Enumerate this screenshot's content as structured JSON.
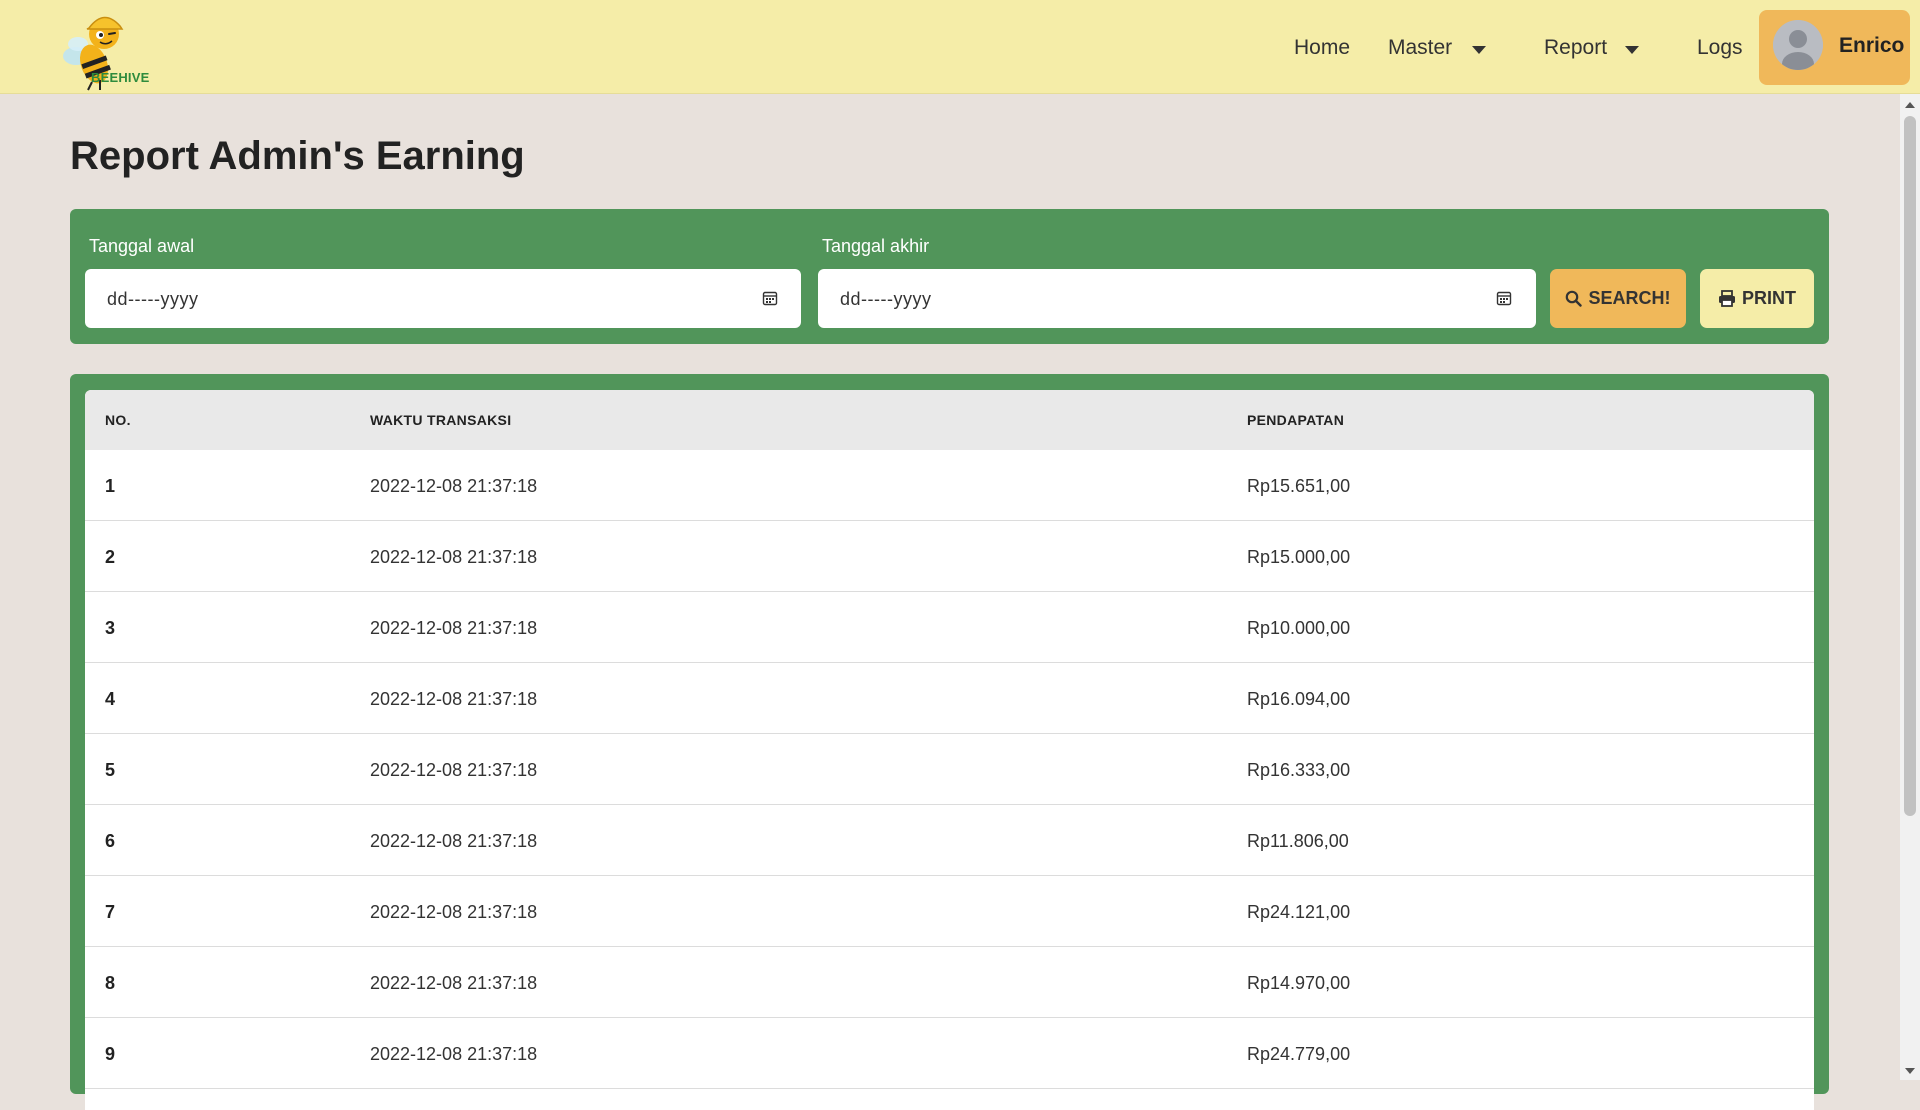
{
  "brand": {
    "logo_text": "BEEHIVE"
  },
  "nav": {
    "home": "Home",
    "master": "Master",
    "report": "Report",
    "logs": "Logs",
    "user_name": "Enrico"
  },
  "page": {
    "title": "Report Admin's Earning"
  },
  "filter": {
    "start_label": "Tanggal awal",
    "start_placeholder": "dd-----yyyy",
    "end_label": "Tanggal akhir",
    "end_placeholder": "dd-----yyyy",
    "search_label": "SEARCH!",
    "print_label": "PRINT"
  },
  "table": {
    "columns": [
      "NO.",
      "WAKTU TRANSAKSI",
      "PENDAPATAN"
    ],
    "rows": [
      {
        "no": "1",
        "time": "2022-12-08 21:37:18",
        "earning": "Rp15.651,00"
      },
      {
        "no": "2",
        "time": "2022-12-08 21:37:18",
        "earning": "Rp15.000,00"
      },
      {
        "no": "3",
        "time": "2022-12-08 21:37:18",
        "earning": "Rp10.000,00"
      },
      {
        "no": "4",
        "time": "2022-12-08 21:37:18",
        "earning": "Rp16.094,00"
      },
      {
        "no": "5",
        "time": "2022-12-08 21:37:18",
        "earning": "Rp16.333,00"
      },
      {
        "no": "6",
        "time": "2022-12-08 21:37:18",
        "earning": "Rp11.806,00"
      },
      {
        "no": "7",
        "time": "2022-12-08 21:37:18",
        "earning": "Rp24.121,00"
      },
      {
        "no": "8",
        "time": "2022-12-08 21:37:18",
        "earning": "Rp14.970,00"
      },
      {
        "no": "9",
        "time": "2022-12-08 21:37:18",
        "earning": "Rp24.779,00"
      }
    ]
  },
  "colors": {
    "navbar": "#f5eda8",
    "page_bg": "#e8e1dc",
    "card_green": "#51955a",
    "accent_orange": "#f0b85a"
  }
}
